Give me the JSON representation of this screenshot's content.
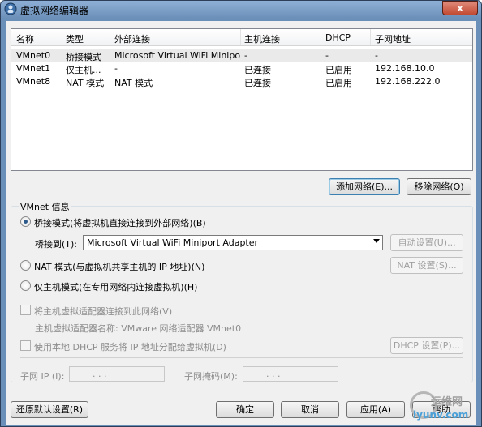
{
  "window": {
    "title": "虚拟网络编辑器",
    "close_glyph": "x"
  },
  "list": {
    "headers": [
      "名称",
      "类型",
      "外部连接",
      "主机连接",
      "DHCP",
      "子网地址"
    ],
    "rows": [
      [
        "VMnet0",
        "桥接模式",
        "Microsoft Virtual WiFi Minipo...",
        "-",
        "-",
        "-"
      ],
      [
        "VMnet1",
        "仅主机...",
        "-",
        "已连接",
        "已启用",
        "192.168.10.0"
      ],
      [
        "VMnet8",
        "NAT 模式",
        "NAT 模式",
        "已连接",
        "已启用",
        "192.168.222.0"
      ]
    ],
    "selected_row": 0
  },
  "buttons": {
    "add_network": "添加网络(E)...",
    "remove_network": "移除网络(O)",
    "auto_settings": "自动设置(U)...",
    "nat_settings": "NAT 设置(S)...",
    "dhcp_settings": "DHCP 设置(P)...",
    "restore_defaults": "还原默认设置(R)",
    "ok": "确定",
    "cancel": "取消",
    "apply": "应用(A)",
    "help": "帮助"
  },
  "vmnet_info": {
    "group_label": "VMnet 信息",
    "bridged_label": "桥接模式(将虚拟机直接连接到外部网络)(B)",
    "bridged_to_label": "桥接到(T):",
    "bridged_to_value": "Microsoft Virtual WiFi Miniport Adapter",
    "nat_label": "NAT 模式(与虚拟机共享主机的 IP 地址)(N)",
    "hostonly_label": "仅主机模式(在专用网络内连接虚拟机)(H)",
    "selected_mode": "bridged",
    "connect_adapter_label": "将主机虚拟适配器连接到此网络(V)",
    "adapter_name_label": "主机虚拟适配器名称: VMware 网络适配器 VMnet0",
    "use_dhcp_label": "使用本地 DHCP 服务将 IP 地址分配给虚拟机(D)",
    "subnet_ip_label": "子网 IP (I):",
    "subnet_mask_label": "子网掩码(M):",
    "ip_dots": ".    .    ."
  },
  "watermark": {
    "cn": "运维网",
    "url": "iyunv.com"
  },
  "colors": {
    "titlebar": "#6a8fb8",
    "close": "#c24a32",
    "selected_row": "#eaeaea",
    "watermark_url": "#4aa0d8"
  }
}
